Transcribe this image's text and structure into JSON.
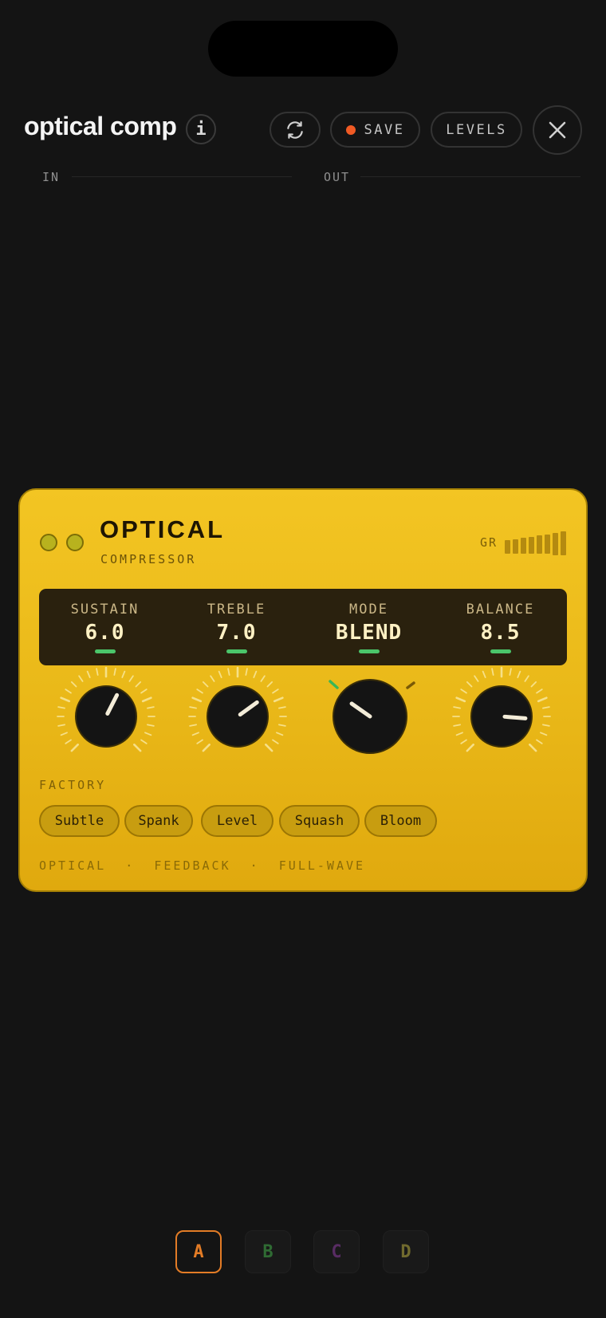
{
  "header": {
    "title": "optical comp",
    "info_label": "i",
    "save_label": "SAVE",
    "levels_label": "LEVELS"
  },
  "meters": {
    "in_label": "IN",
    "out_label": "OUT"
  },
  "plugin": {
    "name": "OPTICAL",
    "subtitle": "COMPRESSOR",
    "gr_label": "GR",
    "params": [
      {
        "label": "SUSTAIN",
        "value": "6.0"
      },
      {
        "label": "TREBLE",
        "value": "7.0"
      },
      {
        "label": "MODE",
        "value": "BLEND"
      },
      {
        "label": "BALANCE",
        "value": "8.5"
      }
    ],
    "factory_label": "FACTORY",
    "presets": [
      "Subtle",
      "Spank",
      "Level",
      "Squash",
      "Bloom"
    ],
    "footer": "OPTICAL  ·  FEEDBACK  ·  FULL-WAVE",
    "indicator_color": "#4bc56a"
  },
  "slots": [
    {
      "label": "A",
      "color": "#e37c26",
      "active": true
    },
    {
      "label": "B",
      "color": "#2f6b33",
      "active": false
    },
    {
      "label": "C",
      "color": "#582c63",
      "active": false
    },
    {
      "label": "D",
      "color": "#706a2e",
      "active": false
    }
  ],
  "colors": {
    "background": "#141414",
    "panel": "#f0c020",
    "accent": "#f05a24"
  }
}
